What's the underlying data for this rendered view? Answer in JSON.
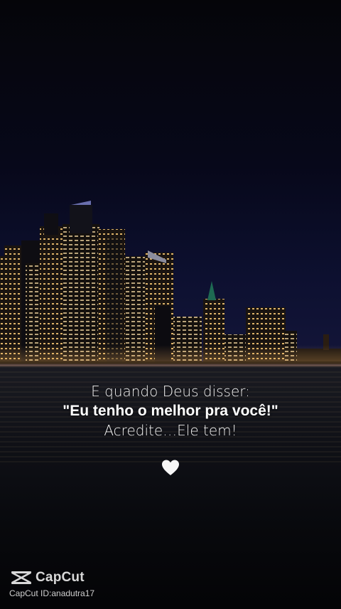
{
  "quote": {
    "line1": "E quando Deus disser:",
    "line2": "\"Eu tenho o melhor pra você!\"",
    "line3": "Acredite…Ele tem!"
  },
  "heart_icon": "white-heart-icon",
  "watermark": {
    "brand": "CapCut",
    "id_text": "CapCut ID:anadutra17"
  },
  "colors": {
    "text": "#f2f2f2",
    "city_lights": "#ffcf7a",
    "sky": "#07081a"
  }
}
